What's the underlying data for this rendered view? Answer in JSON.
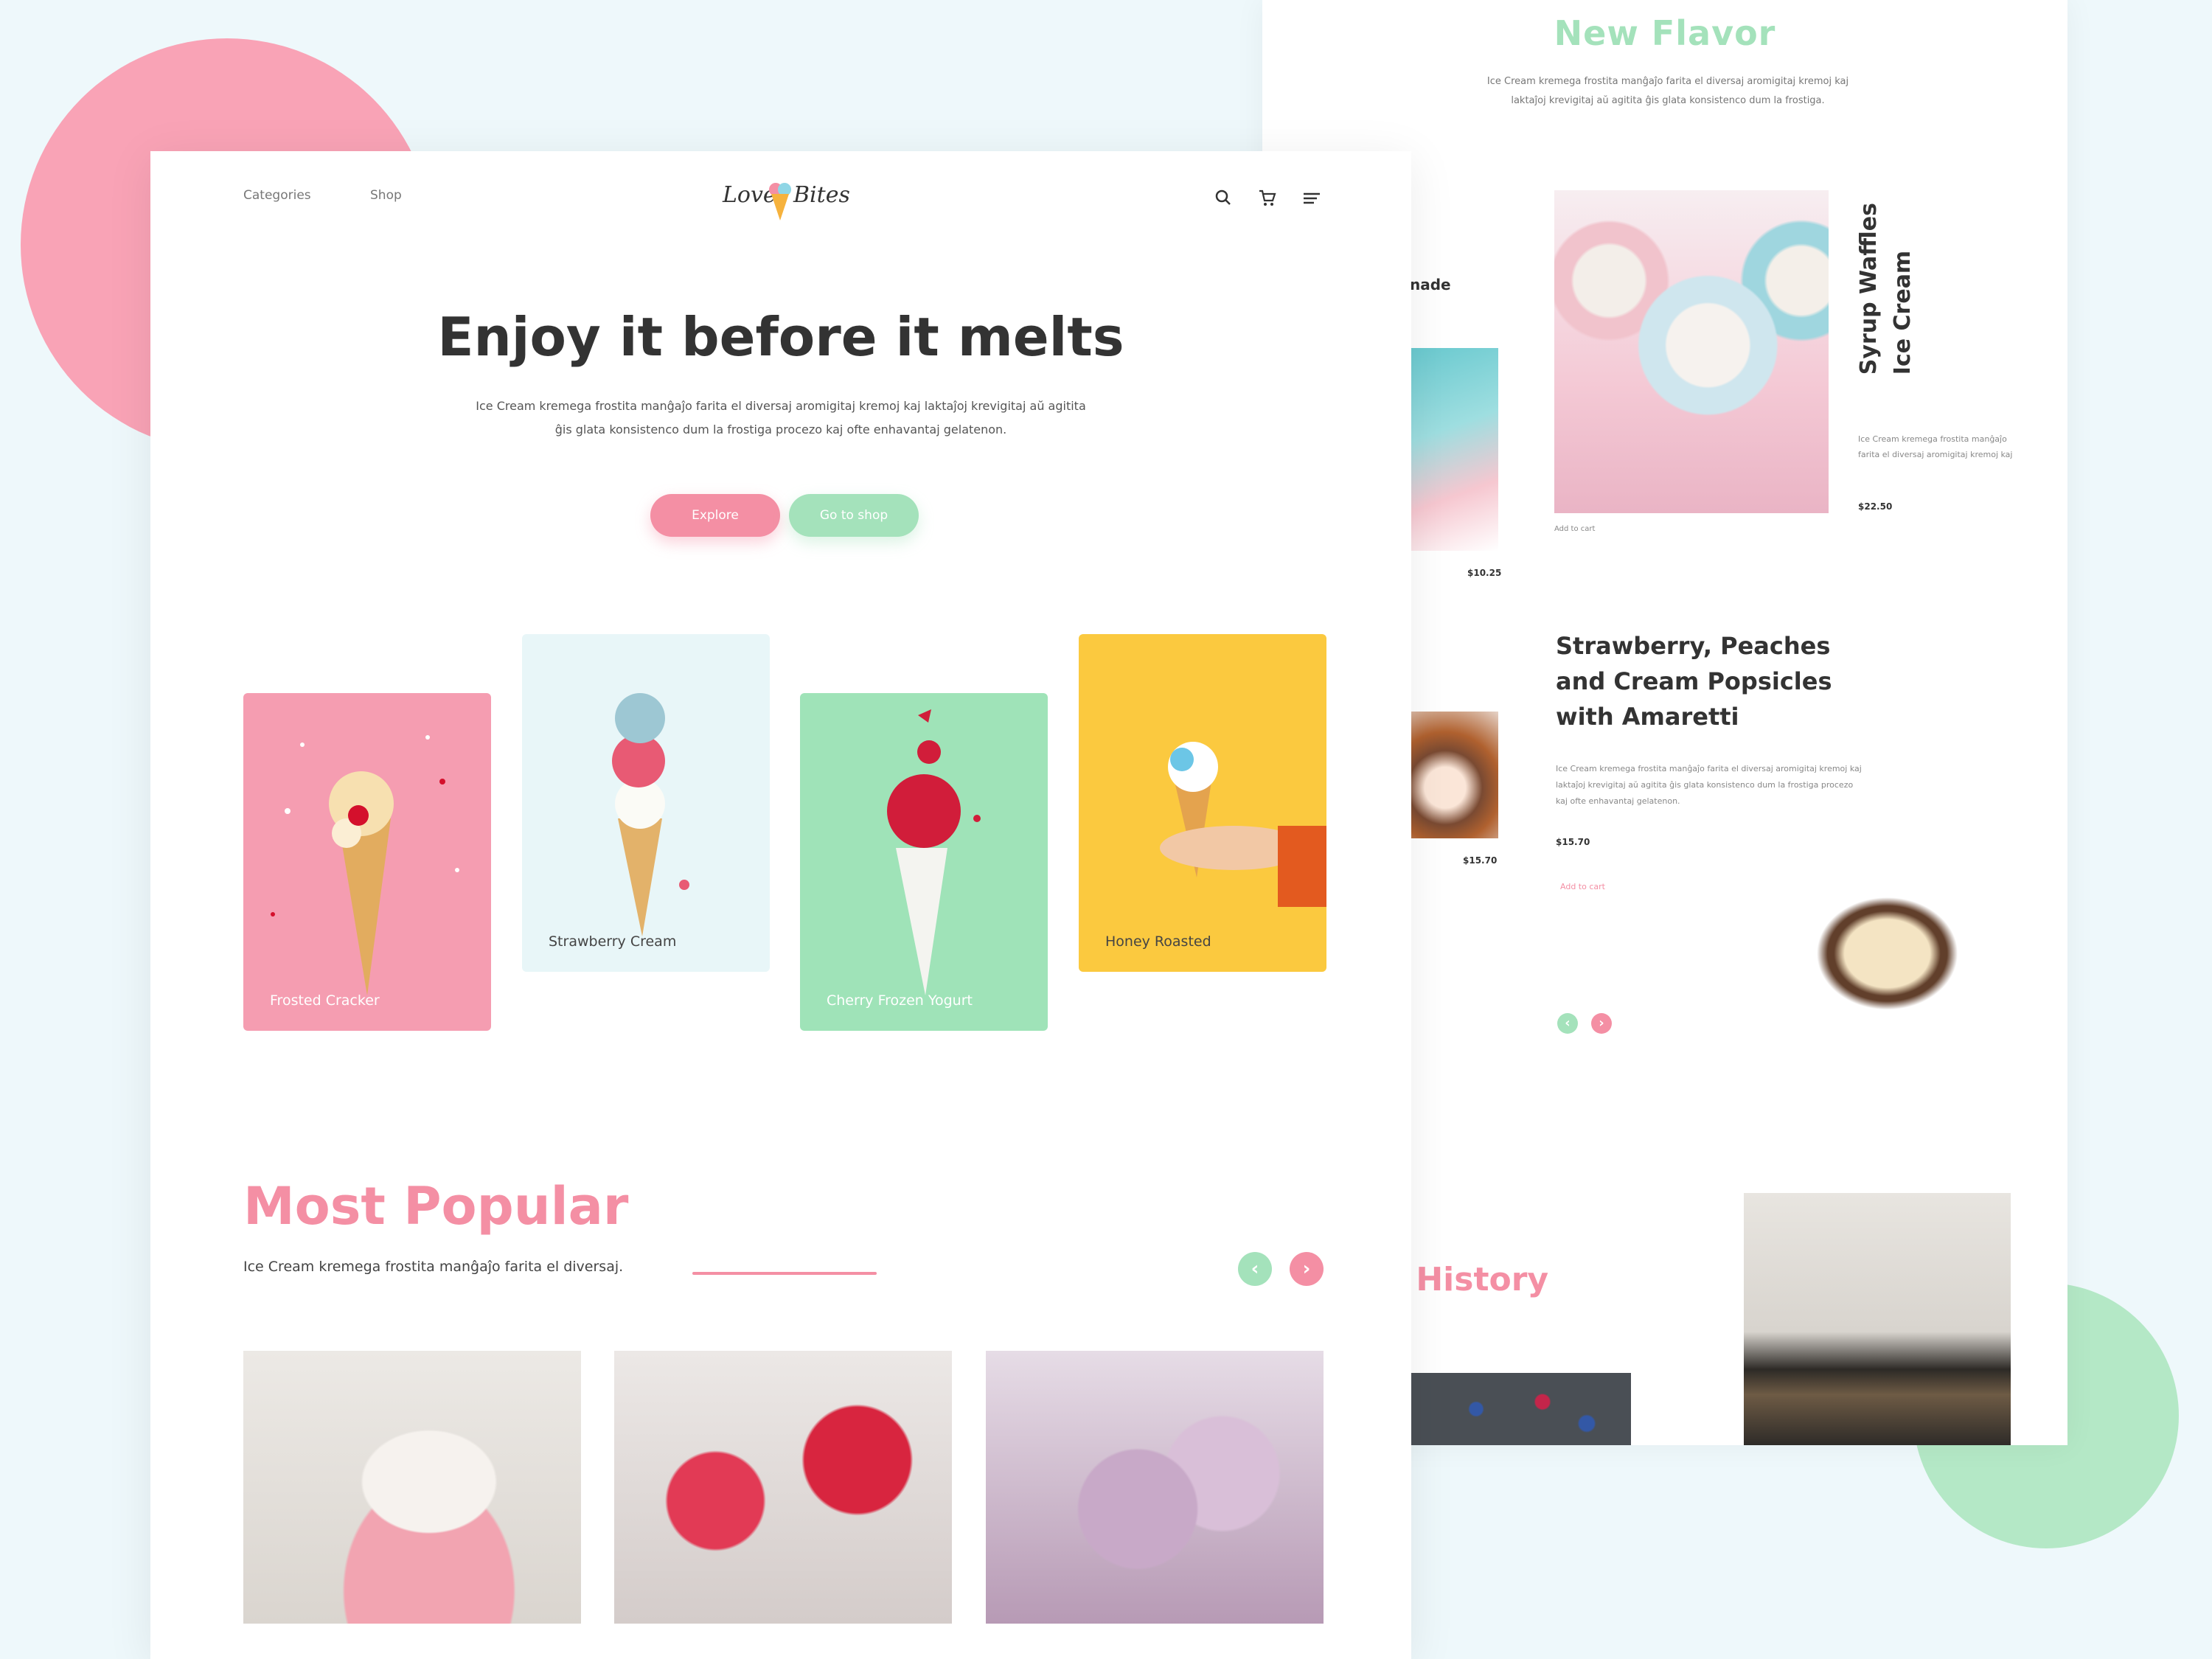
{
  "new_flavor": {
    "title": "New Flavor",
    "description": "Ice Cream kremega frostita manĝaĵo farita el diversaj aromigitaj kremoj kaj laktaĵoj krevigitaj aŭ agitita ĝis glata konsistenco dum la frostiga."
  },
  "back_page": {
    "peek_label": "nade",
    "peek_price_1": "$10.25",
    "peek_price_2": "$15.70",
    "syrup_waffles": {
      "title_line1": "Syrup Waffles",
      "title_line2": "Ice Cream",
      "description": "Ice Cream kremega frostita manĝaĵo farita el diversaj aromigitaj kremoj kaj",
      "price": "$22.50",
      "add_to_cart": "Add to cart"
    },
    "popsicles": {
      "title": "Strawberry, Peaches and Cream Popsicles with Amaretti",
      "description": "Ice Cream kremega frostita manĝaĵo farita el diversaj aromigitaj kremoj kaj laktaĵoj krevigitaj aŭ agitita ĝis glata konsistenco dum la frostiga procezo kaj ofte enhavantaj gelatenon.",
      "price": "$15.70",
      "add_to_cart": "Add to cart"
    },
    "history_title": "ur History"
  },
  "nav": {
    "categories": "Categories",
    "shop": "Shop",
    "logo_left": "Love",
    "logo_right": "Bites",
    "icons": [
      "search-icon",
      "cart-icon",
      "menu-icon"
    ]
  },
  "hero": {
    "title": "Enjoy it before it melts",
    "description": "Ice Cream kremega frostita manĝaĵo farita el diversaj aromigitaj kremoj kaj laktaĵoj krevigitaj aŭ agitita ĝis glata konsistenco dum la frostiga procezo kaj ofte enhavantaj gelatenon.",
    "explore_label": "Explore",
    "shop_label": "Go to shop"
  },
  "categories": [
    {
      "label": "Frosted Cracker",
      "color": "#f59db1"
    },
    {
      "label": "Strawberry Cream",
      "color": "#e8f6f8"
    },
    {
      "label": "Cherry Frozen Yogurt",
      "color": "#9fe3b8"
    },
    {
      "label": "Honey Roasted",
      "color": "#fbc93f"
    }
  ],
  "most_popular": {
    "title": "Most Popular",
    "description": "Ice Cream kremega frostita manĝaĵo farita el diversaj."
  },
  "colors": {
    "accent_pink": "#f48fa4",
    "accent_green": "#a4e2bb"
  }
}
